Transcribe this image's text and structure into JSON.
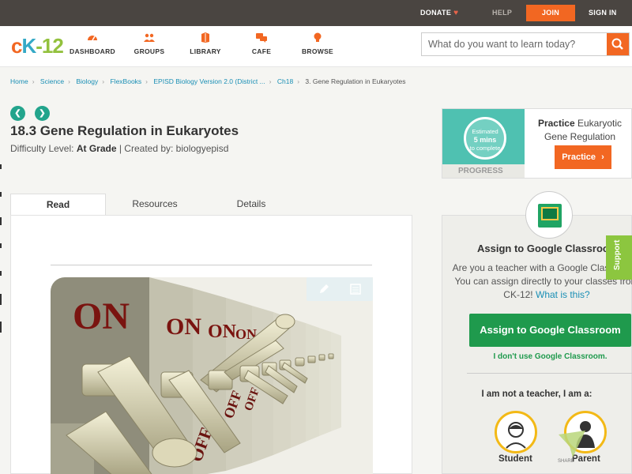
{
  "topbar": {
    "donate": "DONATE",
    "help": "HELP",
    "join": "JOIN",
    "signin": "SIGN IN"
  },
  "header": {
    "logo": {
      "c": "c",
      "k": "K",
      "dash": "-",
      "num": "12"
    },
    "nav": [
      {
        "label": "DASHBOARD",
        "icon": "dashboard-icon"
      },
      {
        "label": "GROUPS",
        "icon": "groups-icon"
      },
      {
        "label": "LIBRARY",
        "icon": "library-icon"
      },
      {
        "label": "CAFE",
        "icon": "cafe-icon"
      },
      {
        "label": "BROWSE",
        "icon": "browse-icon"
      }
    ],
    "search_placeholder": "What do you want to learn today?"
  },
  "breadcrumb": [
    "Home",
    "Science",
    "Biology",
    "FlexBooks",
    "EPISD Biology Version 2.0 (District ...",
    "Ch18",
    "3. Gene Regulation in Eukaryotes"
  ],
  "lesson": {
    "title": "18.3 Gene Regulation in Eukaryotes",
    "difficulty_label": "Difficulty Level:",
    "difficulty_value": "At Grade",
    "created_by": "| Created by: biologyepisd"
  },
  "tabs": [
    "Read",
    "Resources",
    "Details"
  ],
  "image_switch_labels": [
    "ON",
    "ON",
    "ON",
    "ON",
    "ON",
    "OFF",
    "OFF",
    "OFF"
  ],
  "practice": {
    "ring_line1": "Estimated",
    "ring_line2": "5 mins",
    "ring_line3": "to complete",
    "progress": "PROGRESS",
    "text_bold": "Practice",
    "text_rest": "Eukaryotic Gene Regulation",
    "button": "Practice"
  },
  "assign": {
    "title": "Assign to Google Classroom",
    "desc_1": "Are you a teacher with a Google Classroom? You can assign directly to your classes from CK-12!",
    "desc_link": "What is this?",
    "button": "Assign to Google Classroom",
    "no_gc": "I don't use Google Classroom.",
    "not_teacher": "I am not a teacher, I am a:",
    "student": "Student",
    "parent": "Parent"
  },
  "support": "Support",
  "share": "SHARE",
  "colors": {
    "accent_orange": "#f26722",
    "teal": "#22a48c",
    "google_green": "#1f9a4d",
    "link_blue": "#1a8fb5",
    "support_green": "#8cc63f"
  }
}
